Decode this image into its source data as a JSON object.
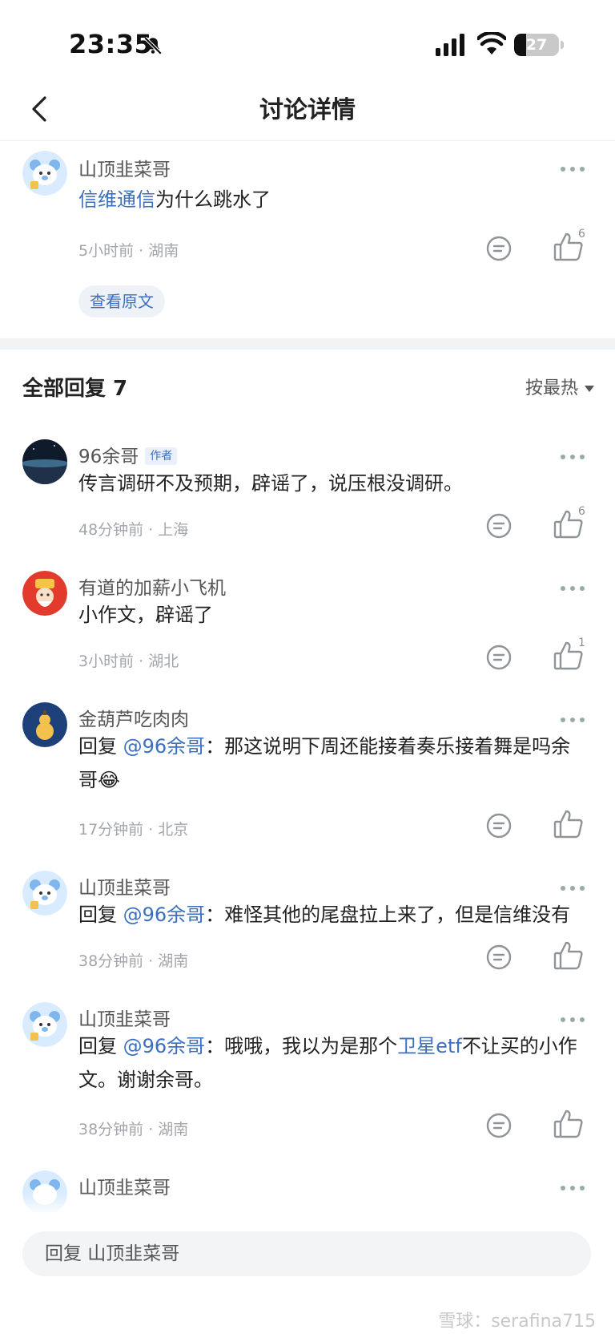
{
  "status": {
    "time": "23:35",
    "battery": "27",
    "battery_level": 0.27
  },
  "nav": {
    "title": "讨论详情"
  },
  "post": {
    "username": "山顶韭菜哥",
    "text_link": "信维通信",
    "text_rest": "为什么跳水了",
    "meta": "5小时前 · 湖南",
    "likes": "6",
    "view_original": "查看原文"
  },
  "replies_header": {
    "title": "全部回复 7",
    "sort": "按最热"
  },
  "replies": [
    {
      "username": "96余哥",
      "badge": "作者",
      "text": "传言调研不及预期，辟谣了，说压根没调研。",
      "meta": "48分钟前 · 上海",
      "likes": "6"
    },
    {
      "username": "有道的加薪小飞机",
      "text": "小作文，辟谣了",
      "meta": "3小时前 · 湖北",
      "likes": "1"
    },
    {
      "username": "金葫芦吃肉肉",
      "reply_prefix": "回复 ",
      "mention": "@96余哥",
      "text": "：那这说明下周还能接着奏乐接着舞是吗余哥😂",
      "meta": "17分钟前 · 北京",
      "likes": ""
    },
    {
      "username": "山顶韭菜哥",
      "reply_prefix": "回复 ",
      "mention": "@96余哥",
      "text": "：难怪其他的尾盘拉上来了，但是信维没有",
      "meta": "38分钟前 · 湖南",
      "likes": ""
    },
    {
      "username": "山顶韭菜哥",
      "reply_prefix": "回复 ",
      "mention": "@96余哥",
      "text_a": "：哦哦，我以为是那个",
      "link": "卫星etf",
      "text_b": "不让买的小作文。谢谢余哥。",
      "meta": "38分钟前 · 湖南",
      "likes": ""
    },
    {
      "username": "山顶韭菜哥"
    }
  ],
  "input": {
    "placeholder": "回复 山顶韭菜哥"
  },
  "watermark": "雪球：serafina715",
  "colors": {
    "link": "#3b6fc0",
    "meta": "#a2a6ab",
    "divider": "#f2f3f5"
  }
}
